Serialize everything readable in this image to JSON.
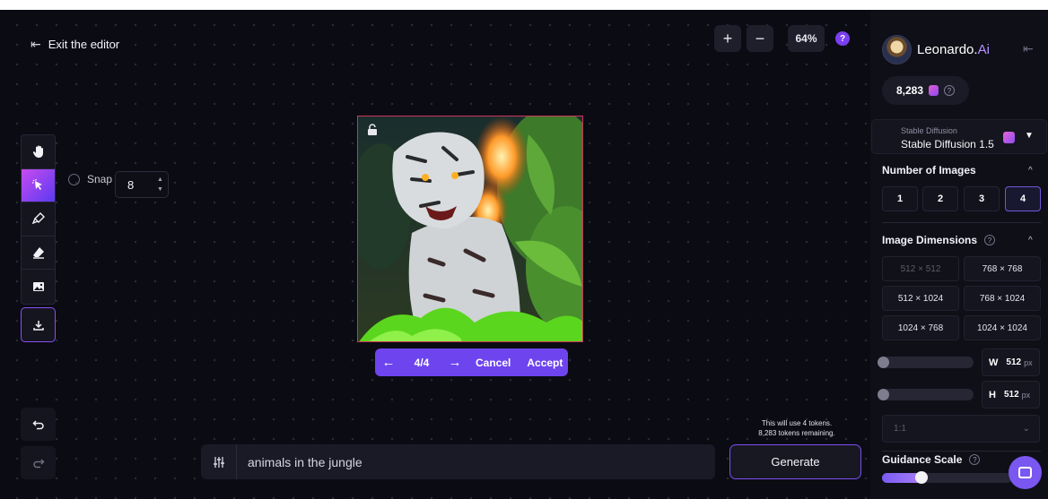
{
  "editor": {
    "exit_label": "Exit the editor",
    "zoom_in": "+",
    "zoom_out": "−",
    "zoom_level": "64%",
    "help": "?"
  },
  "tools": [
    {
      "name": "hand-icon",
      "active": false
    },
    {
      "name": "select-icon",
      "active": true
    },
    {
      "name": "brush-icon",
      "active": false
    },
    {
      "name": "eraser-icon",
      "active": false
    },
    {
      "name": "image-icon",
      "active": false
    }
  ],
  "snap": {
    "label": "Snap",
    "value": "8"
  },
  "canvas": {
    "nav_prev": "←",
    "nav_count": "4/4",
    "nav_next": "→",
    "cancel_label": "Cancel",
    "accept_label": "Accept"
  },
  "prompt": {
    "text": "animals in the jungle"
  },
  "generate": {
    "note_line1": "This will use 4 tokens.",
    "note_line2": "8,283 tokens remaining.",
    "label": "Generate"
  },
  "panel": {
    "brand_name": "Leonardo.",
    "brand_ai": "Ai",
    "credits": "8,283",
    "model_sub": "Stable Diffusion",
    "model_name": "Stable Diffusion 1.5",
    "num_images_title": "Number of Images",
    "num_images": [
      "1",
      "2",
      "3",
      "4"
    ],
    "num_images_selected": "4",
    "dimensions_title": "Image Dimensions",
    "dimensions": [
      "512 × 512",
      "768 × 768",
      "512 × 1024",
      "768 × 1024",
      "1024 × 768",
      "1024 × 1024"
    ],
    "width_label": "W",
    "width_value": "512",
    "height_label": "H",
    "height_value": "512",
    "unit": "px",
    "ratio": "1:1",
    "guidance_title": "Guidance Scale",
    "guidance_level": 0.3
  },
  "colors": {
    "accent": "#6d44ee",
    "brand_accent": "#b692ff",
    "frame_border": "#d0335a"
  }
}
